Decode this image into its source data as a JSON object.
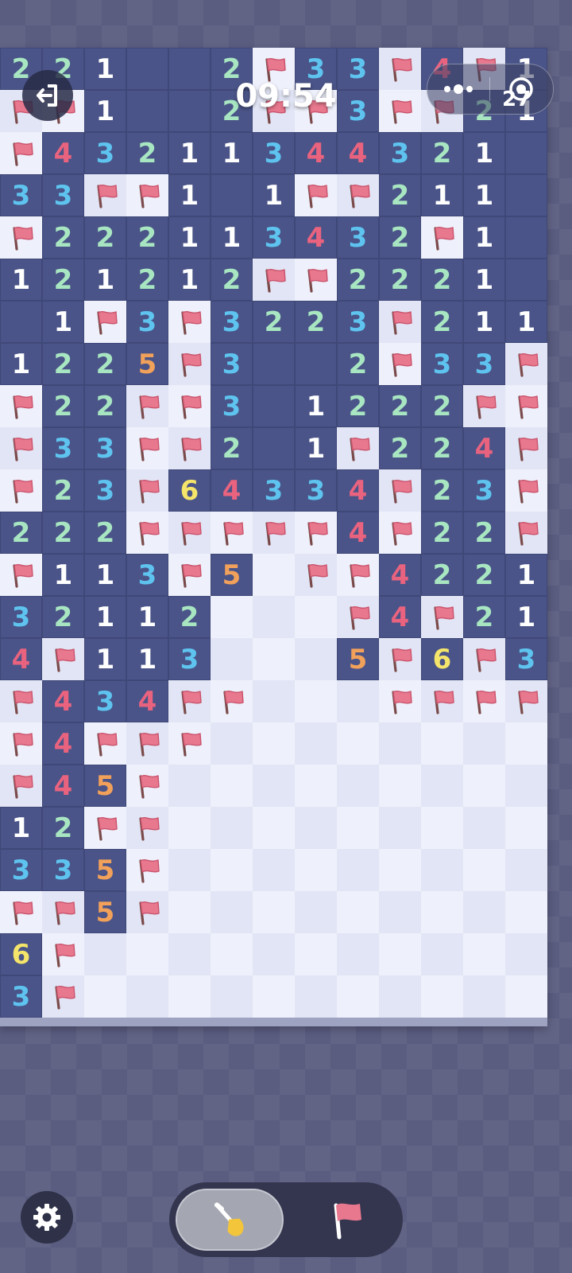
{
  "timer": "09:54",
  "capsule_badge": "27",
  "grid": {
    "cols": 13,
    "rows": 23,
    "cells": [
      "2,2,1,0,0,2,F,3,3,F,4,F,1",
      "F,F,1,0,0,2,F,F,3,F,F,2,1",
      "F,4,3,2,1,1,3,4,4,3,2,1,0",
      "3,3,F,F,1,0,1,F,F,2,1,1,0",
      "F,2,2,2,1,1,3,4,3,2,F,1,0",
      "1,2,1,2,1,2,F,F,2,2,2,1,0",
      "0,1,F,3,F,3,2,2,3,F,2,1,1",
      "1,2,2,5,F,3,0,0,2,F,3,3,F",
      "F,2,2,F,F,3,0,1,2,2,2,F,F",
      "F,3,3,F,F,2,0,1,F,2,2,4,F",
      "F,2,3,F,6,4,3,3,4,F,2,3,F",
      "2,2,2,F,F,F,F,F,4,F,2,2,F",
      "F,1,1,3,F,5,H,F,F,4,2,2,1",
      "3,2,1,1,2,H,H,H,F,4,F,2,1",
      "4,F,1,1,3,H,H,H,5,F,6,F,3",
      "F,4,3,4,F,F,H,H,H,F,F,F,F",
      "F,4,F,F,F,H,H,H,H,H,H,H,H",
      "F,4,5,F,H,H,H,H,H,H,H,H,H",
      "1,2,F,F,H,H,H,H,H,H,H,H,H",
      "3,3,5,F,H,H,H,H,H,H,H,H,H",
      "F,F,5,F,H,H,H,H,H,H,H,H,H",
      "6,F,H,H,H,H,H,H,H,H,H,H,H",
      "3,F,H,H,H,H,H,H,H,H,H,H,H"
    ]
  },
  "number_colors": {
    "1": "#ffffff",
    "2": "#a8e6c2",
    "3": "#5ec4ef",
    "4": "#e9637f",
    "5": "#f2a15a",
    "6": "#f5e46a"
  },
  "colors": {
    "flag": "#e8788e",
    "flag_dark": "#c9536c",
    "pole": "#7a4a4a",
    "shovel_blade": "#f3c53a"
  },
  "mode": {
    "selected": "dig",
    "dig_icon": "shovel-icon",
    "flag_icon": "flag-icon"
  },
  "icons": {
    "exit": "exit-icon",
    "more": "more-dots-icon",
    "close": "target-close-icon",
    "settings": "gear-icon"
  }
}
